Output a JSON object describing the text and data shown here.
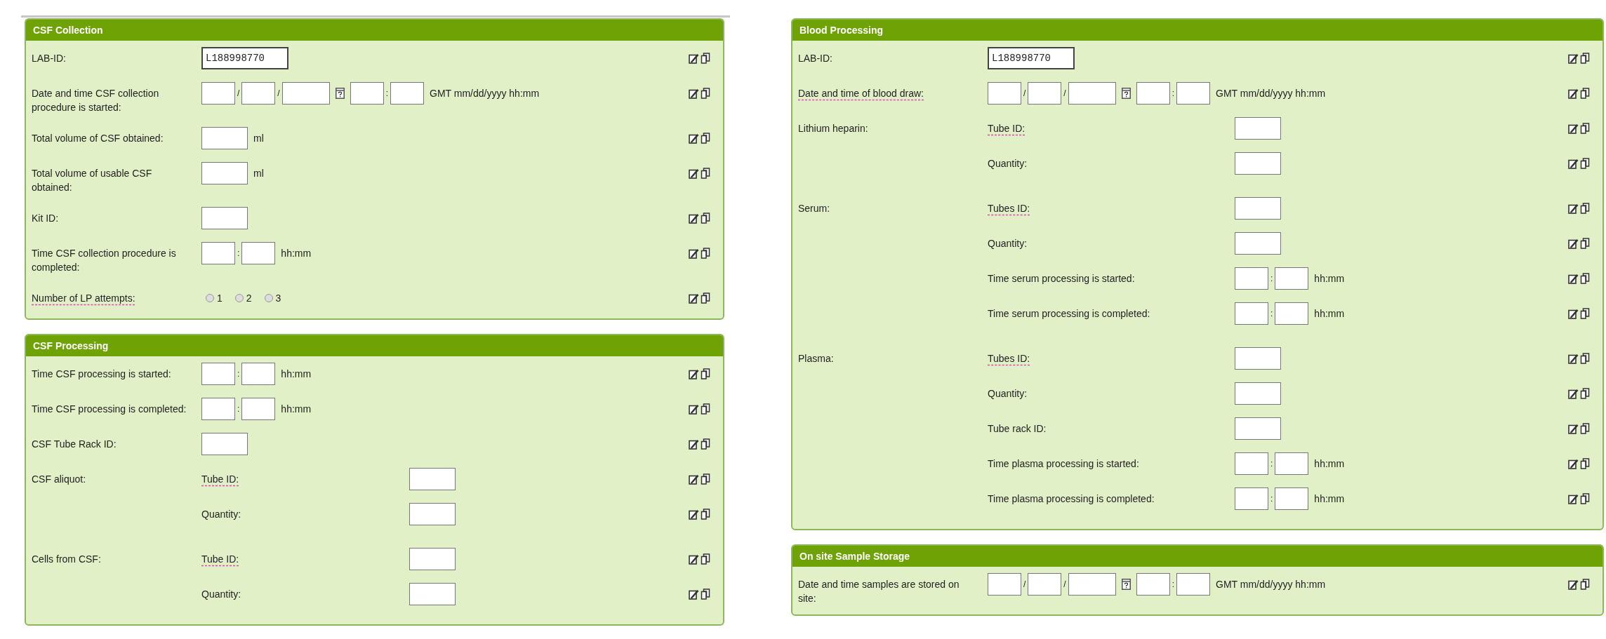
{
  "columns": [
    {
      "panels": [
        {
          "title": "CSF Collection",
          "rows": [
            {
              "kind": "id",
              "label": "LAB-ID:",
              "underlined": false,
              "value": "L188998770"
            },
            {
              "kind": "datetime",
              "label": "Date and time CSF collection procedure is started:",
              "underlined": false,
              "date_sep": "/",
              "time_sep": ":",
              "hint": "GMT mm/dd/yyyy hh:mm"
            },
            {
              "kind": "measure",
              "label": "Total volume of CSF obtained:",
              "underlined": false,
              "unit": "ml"
            },
            {
              "kind": "measure",
              "label": "Total volume of usable CSF obtained:",
              "underlined": false,
              "unit": "ml"
            },
            {
              "kind": "text",
              "label": "Kit ID:",
              "underlined": false
            },
            {
              "kind": "time",
              "label": "Time CSF collection procedure is completed:",
              "underlined": false,
              "time_sep": ":",
              "hint": "hh:mm"
            },
            {
              "kind": "radio",
              "label": "Number of LP attempts:",
              "underlined": true,
              "options": [
                {
                  "label": "1",
                  "selected": false
                },
                {
                  "label": "2",
                  "selected": false
                },
                {
                  "label": "3",
                  "selected": false
                }
              ]
            }
          ]
        },
        {
          "title": "CSF Processing",
          "rows": [
            {
              "kind": "time",
              "label": "Time CSF processing is started:",
              "underlined": false,
              "time_sep": ":",
              "hint": "hh:mm"
            },
            {
              "kind": "time",
              "label": "Time CSF processing is completed:",
              "underlined": false,
              "time_sep": ":",
              "hint": "hh:mm"
            },
            {
              "kind": "text",
              "label": "CSF Tube Rack ID:",
              "underlined": false
            },
            {
              "kind": "group",
              "label": "CSF aliquot:",
              "underlined": false,
              "items": [
                {
                  "kind": "text",
                  "label": "Tube ID:",
                  "underlined": true
                },
                {
                  "kind": "text",
                  "label": "Quantity:",
                  "underlined": false
                }
              ]
            },
            {
              "kind": "group",
              "label": "Cells from CSF:",
              "underlined": false,
              "items": [
                {
                  "kind": "text",
                  "label": "Tube ID:",
                  "underlined": true
                },
                {
                  "kind": "text",
                  "label": "Quantity:",
                  "underlined": false
                }
              ]
            }
          ]
        }
      ]
    },
    {
      "panels": [
        {
          "title": "Blood Processing",
          "rows": [
            {
              "kind": "id",
              "label": "LAB-ID:",
              "underlined": false,
              "value": "L188998770"
            },
            {
              "kind": "datetime",
              "label": "Date and time of blood draw:",
              "underlined": true,
              "date_sep": "/",
              "time_sep": ":",
              "hint": "GMT mm/dd/yyyy hh:mm"
            },
            {
              "kind": "group",
              "label": "Lithium heparin:",
              "underlined": false,
              "items": [
                {
                  "kind": "text",
                  "label": "Tube ID:",
                  "underlined": true
                },
                {
                  "kind": "text",
                  "label": "Quantity:",
                  "underlined": false
                }
              ]
            },
            {
              "kind": "group",
              "label": "Serum:",
              "underlined": false,
              "items": [
                {
                  "kind": "text",
                  "label": "Tubes ID:",
                  "underlined": true
                },
                {
                  "kind": "text",
                  "label": "Quantity:",
                  "underlined": false
                },
                {
                  "kind": "time",
                  "label": "Time serum processing is started:",
                  "underlined": false,
                  "time_sep": ":",
                  "hint": "hh:mm"
                },
                {
                  "kind": "time",
                  "label": "Time serum processing is completed:",
                  "underlined": false,
                  "time_sep": ":",
                  "hint": "hh:mm"
                }
              ]
            },
            {
              "kind": "group",
              "label": "Plasma:",
              "underlined": false,
              "items": [
                {
                  "kind": "text",
                  "label": "Tubes ID:",
                  "underlined": true
                },
                {
                  "kind": "text",
                  "label": "Quantity:",
                  "underlined": false
                },
                {
                  "kind": "text",
                  "label": "Tube rack ID:",
                  "underlined": false
                },
                {
                  "kind": "time",
                  "label": "Time plasma processing is started:",
                  "underlined": false,
                  "time_sep": ":",
                  "hint": "hh:mm"
                },
                {
                  "kind": "time",
                  "label": "Time plasma processing is completed:",
                  "underlined": false,
                  "time_sep": ":",
                  "hint": "hh:mm"
                }
              ]
            }
          ]
        },
        {
          "title": "On site Sample Storage",
          "rows": [
            {
              "kind": "datetime",
              "label": "Date and time samples are stored on site:",
              "underlined": false,
              "date_sep": "/",
              "time_sep": ":",
              "hint": "GMT mm/dd/yyyy hh:mm"
            }
          ]
        }
      ]
    }
  ]
}
